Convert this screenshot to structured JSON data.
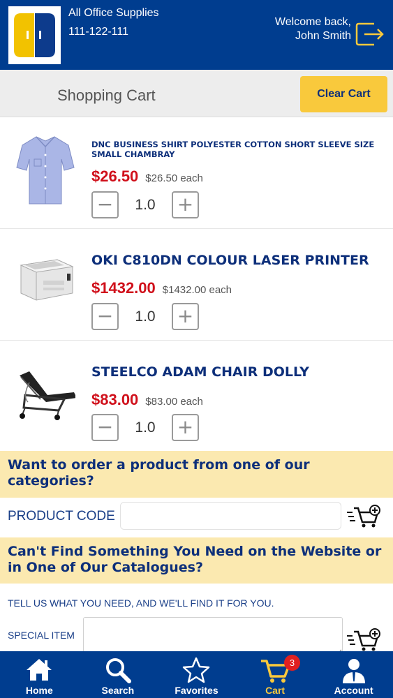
{
  "header": {
    "store_name": "All Office Supplies",
    "phone": "111-122-111",
    "welcome": "Welcome back, John Smith",
    "logout_icon": "logout-icon",
    "colors": {
      "brand_blue": "#003d8f",
      "accent_yellow": "#f9c93c"
    }
  },
  "cart_bar": {
    "title": "Shopping Cart",
    "clear_label": "Clear Cart"
  },
  "items": [
    {
      "name": "DNC BUSINESS SHIRT POLYESTER COTTON SHORT SLEEVE SIZE SMALL CHAMBRAY",
      "price": "$26.50",
      "each": "$26.50 each",
      "qty": "1.0",
      "image": "shirt-image"
    },
    {
      "name": "OKI C810DN COLOUR LASER PRINTER",
      "price": "$1432.00",
      "each": "$1432.00 each",
      "qty": "1.0",
      "image": "printer-image"
    },
    {
      "name": "STEELCO ADAM CHAIR DOLLY",
      "price": "$83.00",
      "each": "$83.00 each",
      "qty": "1.0",
      "image": "chair-dolly-image"
    }
  ],
  "qty_controls": {
    "minus": "−",
    "plus": "+"
  },
  "order_by_category": {
    "heading": "Want to order a product from one of our categories?",
    "code_label": "PRODUCT CODE",
    "code_value": ""
  },
  "special_request": {
    "heading": "Can't Find Something You Need on the Website or in One of Our Catalogues?",
    "tell_us": "TELL US WHAT YOU NEED, AND WE'LL FIND IT FOR YOU.",
    "special_label": "SPECIAL ITEM",
    "special_value": ""
  },
  "nav": {
    "items": [
      {
        "label": "Home",
        "icon": "home-icon"
      },
      {
        "label": "Search",
        "icon": "search-icon"
      },
      {
        "label": "Favorites",
        "icon": "star-icon"
      },
      {
        "label": "Cart",
        "icon": "cart-icon",
        "active": true
      },
      {
        "label": "Account",
        "icon": "account-icon"
      }
    ],
    "cart_badge": "3"
  }
}
